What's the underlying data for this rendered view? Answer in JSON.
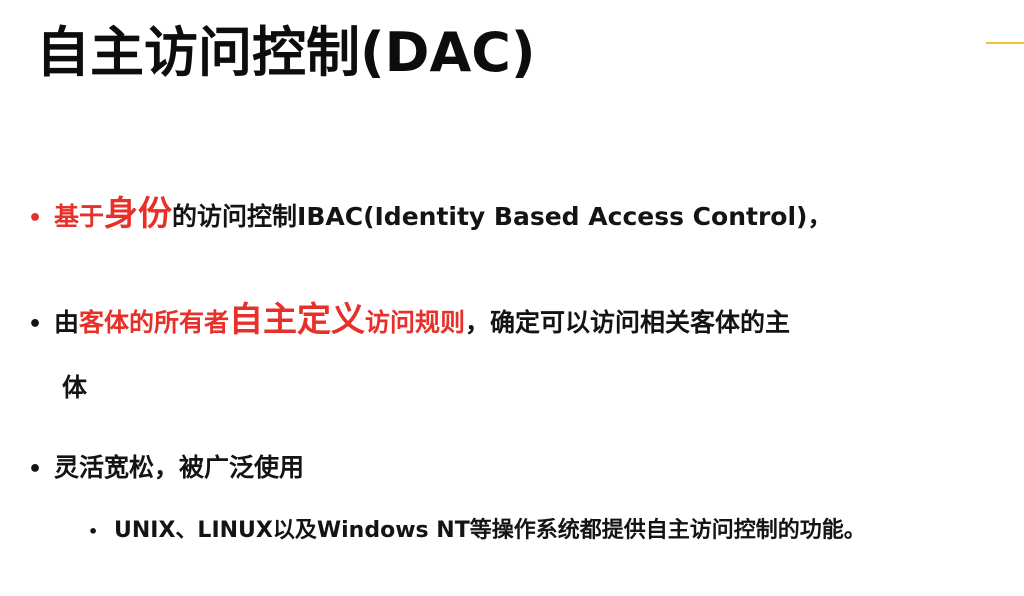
{
  "slide": {
    "title": "自主访问控制(DAC)",
    "accent_color": "#f3c233",
    "highlight_color": "#e8302a",
    "bullets": [
      {
        "segments": [
          {
            "text": "基于",
            "style": "red"
          },
          {
            "text": "身份",
            "style": "red-big"
          },
          {
            "text": "的访问控制IBAC(Identity Based Access Control)，",
            "style": "normal"
          }
        ]
      },
      {
        "segments": [
          {
            "text": "由",
            "style": "normal"
          },
          {
            "text": "客体的所有者",
            "style": "red"
          },
          {
            "text": "自主定义",
            "style": "red-big"
          },
          {
            "text": "访问规则",
            "style": "red"
          },
          {
            "text": "，确定可以访问相关客体的主",
            "style": "normal"
          }
        ],
        "continuation": "体"
      },
      {
        "segments": [
          {
            "text": "灵活宽松，被广泛使用",
            "style": "normal"
          }
        ]
      }
    ],
    "sub_bullets": [
      {
        "text": "UNIX、LINUX以及Windows  NT等操作系统都提供自主访问控制的功能。"
      }
    ],
    "bullet_glyph": "•"
  }
}
